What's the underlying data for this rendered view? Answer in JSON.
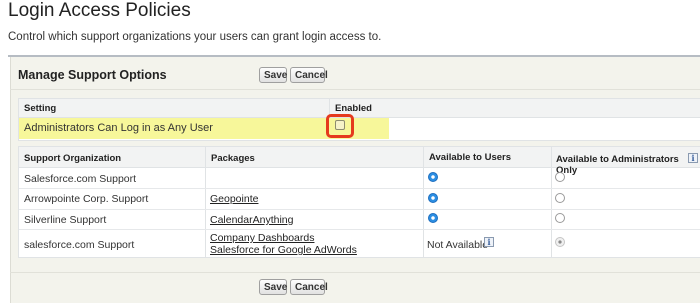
{
  "page": {
    "title": "Login Access Policies",
    "description": "Control which support organizations your users can grant login access to."
  },
  "panel": {
    "title": "Manage Support Options",
    "save_label": "Save",
    "cancel_label": "Cancel"
  },
  "settings_table": {
    "headers": [
      "Setting",
      "Enabled"
    ],
    "row": {
      "label": "Administrators Can Log in as Any User",
      "enabled": false
    }
  },
  "support_table": {
    "headers": [
      "Support Organization",
      "Packages",
      "Available to Users",
      "Available to Administrators Only"
    ],
    "rows": [
      {
        "org": "Salesforce.com Support",
        "packages": [],
        "users": "selected",
        "admins": "unselected"
      },
      {
        "org": "Arrowpointe Corp. Support",
        "packages": [
          "Geopointe"
        ],
        "users": "selected",
        "admins": "unselected"
      },
      {
        "org": "Silverline Support",
        "packages": [
          "CalendarAnything"
        ],
        "users": "selected",
        "admins": "unselected"
      },
      {
        "org": "salesforce.com Support",
        "packages": [
          "Company Dashboards",
          "Salesforce for Google AdWords"
        ],
        "users_text": "Not Available",
        "admins": "selected-disabled"
      }
    ]
  },
  "icons": {
    "info": "i"
  },
  "colors": {
    "highlight_row": "#f7f79a",
    "callout_border": "#e53a1d",
    "radio_selected": "#2b8ee3"
  }
}
